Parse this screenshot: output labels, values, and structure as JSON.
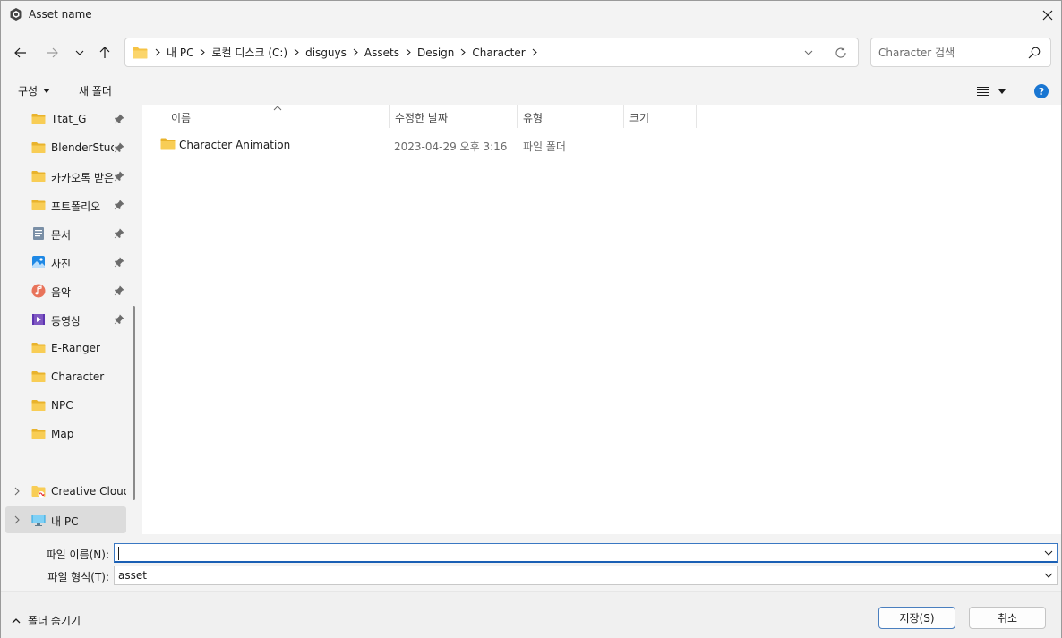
{
  "window": {
    "title": "Asset name"
  },
  "address": {
    "crumbs": [
      "내 PC",
      "로컬 디스크 (C:)",
      "disguys",
      "Assets",
      "Design",
      "Character"
    ]
  },
  "search": {
    "placeholder": "Character 검색"
  },
  "commands": {
    "organize": "구성",
    "new_folder": "새 폴더",
    "help": "?"
  },
  "nav": {
    "items": [
      {
        "label": "Ttat_G",
        "icon": "folder-icon",
        "pinned": true
      },
      {
        "label": "BlenderStudy",
        "icon": "folder-icon",
        "pinned": true
      },
      {
        "label": "카카오톡 받은",
        "icon": "folder-icon",
        "pinned": true
      },
      {
        "label": "포트폴리오",
        "icon": "folder-icon",
        "pinned": true
      },
      {
        "label": "문서",
        "icon": "documents-icon",
        "pinned": true
      },
      {
        "label": "사진",
        "icon": "pictures-icon",
        "pinned": true
      },
      {
        "label": "음악",
        "icon": "music-icon",
        "pinned": true
      },
      {
        "label": "동영상",
        "icon": "videos-icon",
        "pinned": true
      },
      {
        "label": "E-Ranger",
        "icon": "folder-icon",
        "pinned": false
      },
      {
        "label": "Character",
        "icon": "folder-icon",
        "pinned": false
      },
      {
        "label": "NPC",
        "icon": "folder-icon",
        "pinned": false
      },
      {
        "label": "Map",
        "icon": "folder-icon",
        "pinned": false
      }
    ],
    "creative_cloud": "Creative Cloud",
    "this_pc": "내 PC"
  },
  "list": {
    "columns": [
      "이름",
      "수정한 날짜",
      "유형",
      "크기"
    ],
    "rows": [
      {
        "name": "Character Animation",
        "date": "2023-04-29 오후 3:16",
        "type": "파일 폴더",
        "size": ""
      }
    ]
  },
  "form": {
    "filename_label": "파일 이름(N):",
    "filename_value": "",
    "filetype_label": "파일 형식(T):",
    "filetype_value": "asset"
  },
  "footer": {
    "hide_folders": "폴더 숨기기",
    "save": "저장(S)",
    "cancel": "취소"
  },
  "colors": {
    "folder": "#f6c344",
    "accent": "#1976d2"
  }
}
